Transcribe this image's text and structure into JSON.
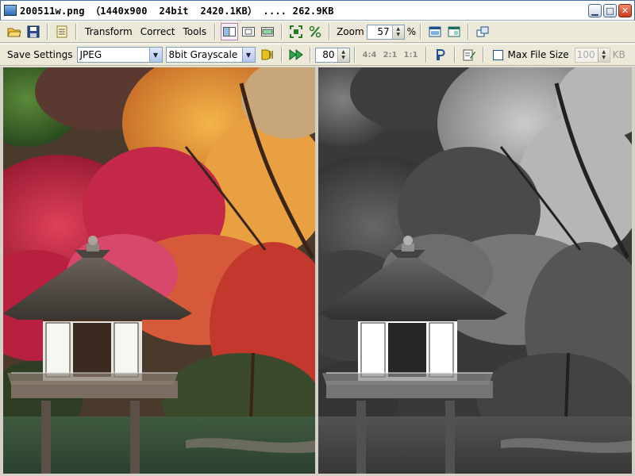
{
  "window": {
    "title": "200511w.png （1440x900  24bit  2420.1KB） .... 262.9KB",
    "buttons": [
      "minimize",
      "maximize",
      "close"
    ]
  },
  "toolbar": {
    "icons_left": [
      "open-folder-icon",
      "save-icon",
      "list-icon"
    ],
    "menus": [
      "Transform",
      "Correct",
      "Tools"
    ],
    "view_icons": [
      "split-view-icon",
      "single-view-icon",
      "side-view-icon"
    ],
    "fit_icons": [
      "fit-icon",
      "percent-icon"
    ],
    "zoom": {
      "label": "Zoom",
      "value": "57",
      "unit": "%"
    },
    "window_icons": [
      "window-a-icon",
      "window-b-icon",
      "window-c-icon"
    ]
  },
  "save_bar": {
    "label": "Save Settings",
    "format": "JPEG",
    "mode": "8bit Grayscale",
    "quality": "80",
    "subsampling": [
      "4:4",
      "2:1",
      "1:1"
    ],
    "max_file_size": {
      "label": "Max File Size",
      "checked": false,
      "value": "100",
      "unit": "KB"
    }
  },
  "colors": {
    "accent": "#b77fb0",
    "title_border": "#4a6fa5",
    "chrome": "#ece9d8"
  }
}
